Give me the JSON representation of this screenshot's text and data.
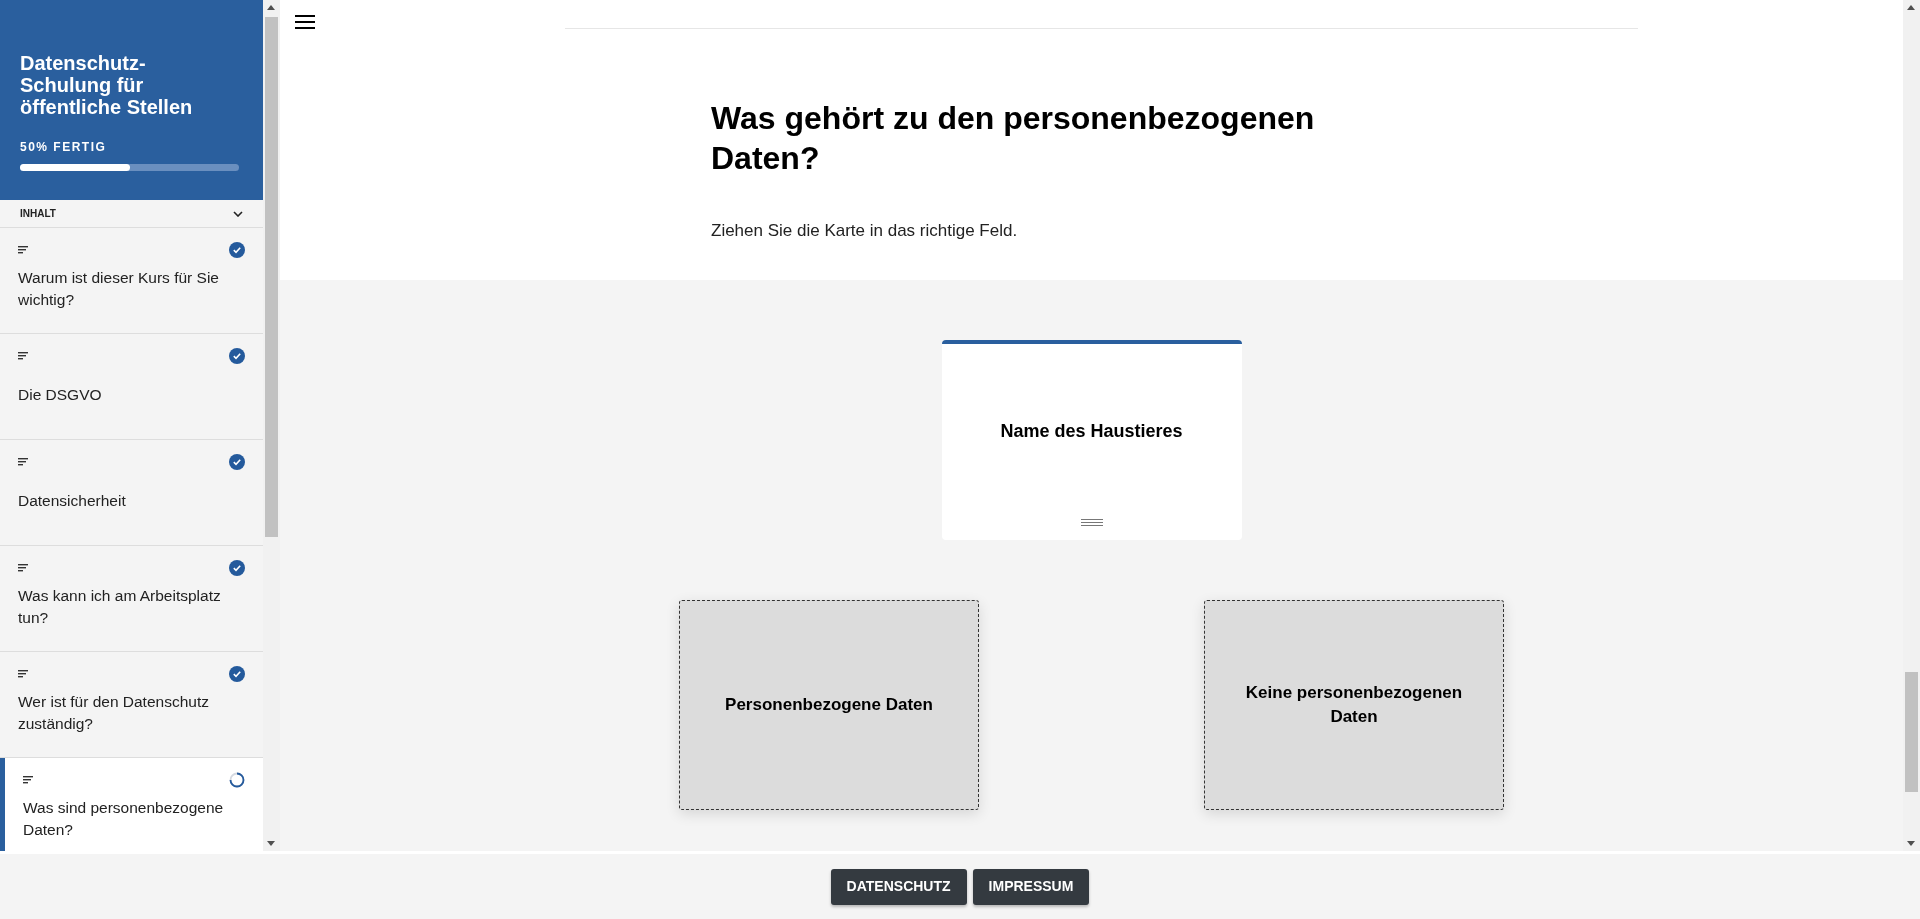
{
  "sidebar": {
    "title": "Datenschutz-Schulung für öffentliche Stellen",
    "progress": {
      "label": "50% FERTIG",
      "level": 0.5
    },
    "section_label": "INHALT",
    "expanded": true,
    "items": [
      {
        "label": "Warum ist dieser Kurs für Sie wichtig?",
        "completed": true,
        "selected": false
      },
      {
        "label": "Die DSGVO",
        "completed": true,
        "selected": false
      },
      {
        "label": "Datensicherheit",
        "completed": true,
        "selected": false
      },
      {
        "label": "Was kann ich am Arbeitsplatz tun?",
        "completed": true,
        "selected": false
      },
      {
        "label": "Wer ist für den Datenschutz zuständig?",
        "completed": true,
        "selected": false
      },
      {
        "label": "Was sind personenbezogene Daten?",
        "completed": false,
        "selected": true
      }
    ]
  },
  "lesson": {
    "heading": "Was gehört zu den personenbezogenen Daten?",
    "instruction": "Ziehen Sie die Karte in das richtige Feld.",
    "card": {
      "label": "Name des Haustieres"
    },
    "drop_zones": [
      {
        "label": "Personenbezogene Daten"
      },
      {
        "label": "Keine personenbezogenen Daten"
      }
    ]
  },
  "footer": {
    "buttons": [
      "DATENSCHUTZ",
      "IMPRESSUM"
    ]
  }
}
